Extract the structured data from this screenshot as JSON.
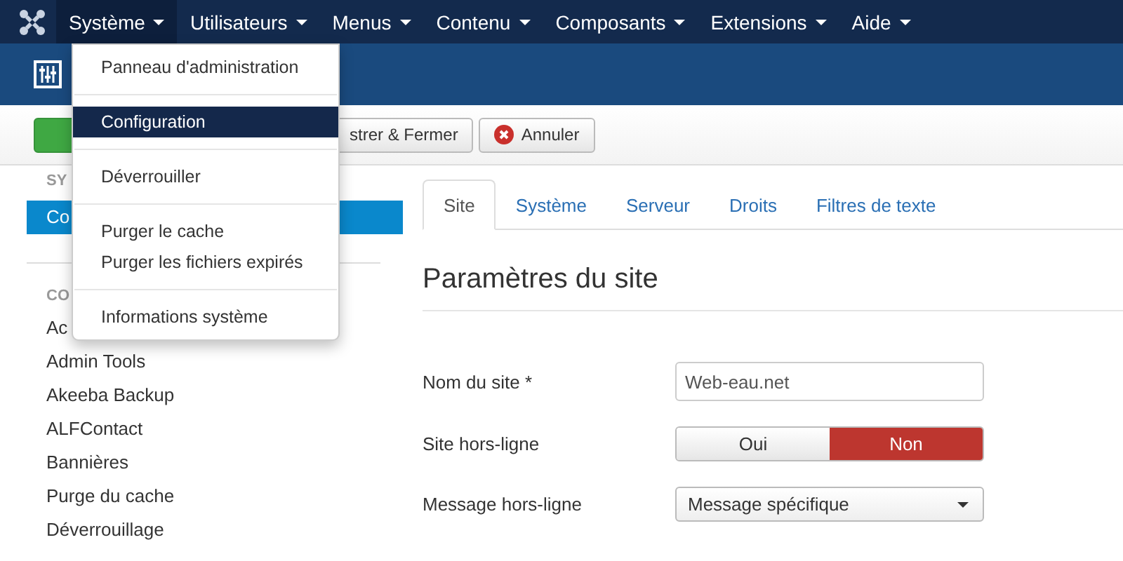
{
  "navbar": {
    "items": [
      {
        "label": "Système",
        "selected": true
      },
      {
        "label": "Utilisateurs",
        "selected": false
      },
      {
        "label": "Menus",
        "selected": false
      },
      {
        "label": "Contenu",
        "selected": false
      },
      {
        "label": "Composants",
        "selected": false
      },
      {
        "label": "Extensions",
        "selected": false
      },
      {
        "label": "Aide",
        "selected": false
      }
    ]
  },
  "dropdown": {
    "groups": [
      [
        {
          "label": "Panneau d'administration",
          "selected": false
        }
      ],
      [
        {
          "label": "Configuration",
          "selected": true
        }
      ],
      [
        {
          "label": "Déverrouiller",
          "selected": false
        }
      ],
      [
        {
          "label": "Purger le cache",
          "selected": false
        },
        {
          "label": "Purger les fichiers expirés",
          "selected": false
        }
      ],
      [
        {
          "label": "Informations système",
          "selected": false
        }
      ]
    ]
  },
  "toolbar": {
    "buttons": [
      {
        "kind": "success"
      },
      {
        "kind": "plain",
        "label": "strer & Fermer"
      },
      {
        "kind": "cancel",
        "label": "Annuler"
      }
    ]
  },
  "sidebar": {
    "sections": [
      {
        "heading": "SY",
        "items": [
          {
            "label": "Co",
            "selected": true
          }
        ]
      },
      {
        "heading": "CO",
        "items": [
          {
            "label": "Ac",
            "selected": false
          },
          {
            "label": "Admin Tools",
            "selected": false
          },
          {
            "label": "Akeeba Backup",
            "selected": false
          },
          {
            "label": "ALFContact",
            "selected": false
          },
          {
            "label": "Bannières",
            "selected": false
          },
          {
            "label": "Purge du cache",
            "selected": false
          },
          {
            "label": "Déverrouillage",
            "selected": false
          }
        ]
      }
    ]
  },
  "tabs": [
    {
      "label": "Site",
      "selected": true
    },
    {
      "label": "Système",
      "selected": false
    },
    {
      "label": "Serveur",
      "selected": false
    },
    {
      "label": "Droits",
      "selected": false
    },
    {
      "label": "Filtres de texte",
      "selected": false
    }
  ],
  "section_title": "Paramètres du site",
  "fields": [
    {
      "kind": "text",
      "label": "Nom du site *",
      "value": "Web-eau.net"
    },
    {
      "kind": "toggle",
      "label": "Site hors-ligne",
      "options": [
        {
          "label": "Oui",
          "selected": false
        },
        {
          "label": "Non",
          "selected": true
        }
      ]
    },
    {
      "kind": "select",
      "label": "Message hors-ligne",
      "value": "Message spécifique"
    }
  ]
}
